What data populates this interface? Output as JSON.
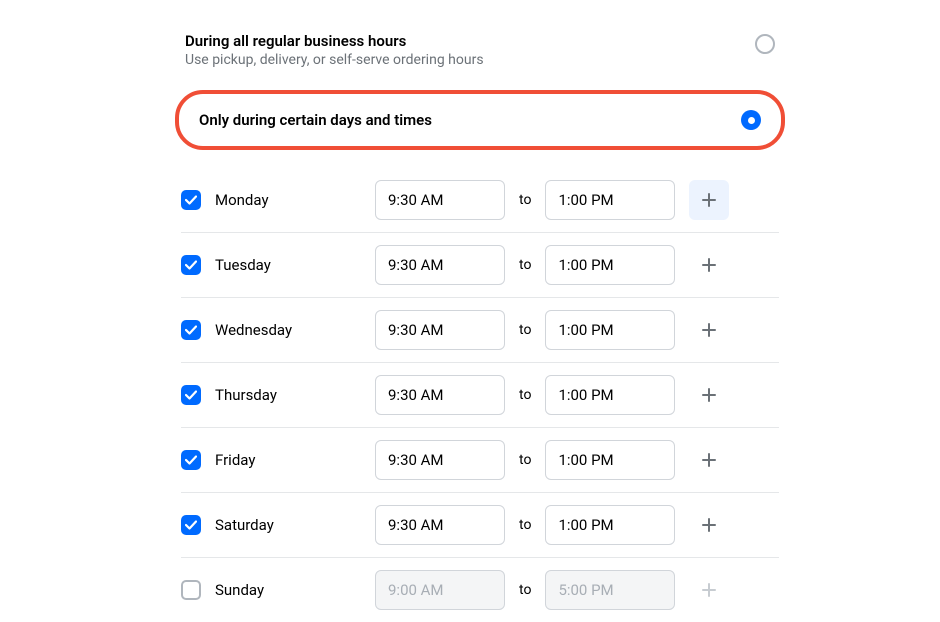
{
  "options": {
    "regular": {
      "title": "During all regular business hours",
      "subtitle": "Use pickup, delivery, or self-serve ordering hours"
    },
    "custom": {
      "title": "Only during certain days and times"
    }
  },
  "separator": "to",
  "days": [
    {
      "label": "Monday",
      "checked": true,
      "start": "9:30 AM",
      "end": "1:00 PM",
      "addHighlighted": true
    },
    {
      "label": "Tuesday",
      "checked": true,
      "start": "9:30 AM",
      "end": "1:00 PM",
      "addHighlighted": false
    },
    {
      "label": "Wednesday",
      "checked": true,
      "start": "9:30 AM",
      "end": "1:00 PM",
      "addHighlighted": false
    },
    {
      "label": "Thursday",
      "checked": true,
      "start": "9:30 AM",
      "end": "1:00 PM",
      "addHighlighted": false
    },
    {
      "label": "Friday",
      "checked": true,
      "start": "9:30 AM",
      "end": "1:00 PM",
      "addHighlighted": false
    },
    {
      "label": "Saturday",
      "checked": true,
      "start": "9:30 AM",
      "end": "1:00 PM",
      "addHighlighted": false
    },
    {
      "label": "Sunday",
      "checked": false,
      "start": "9:00 AM",
      "end": "5:00 PM",
      "addHighlighted": false
    }
  ]
}
